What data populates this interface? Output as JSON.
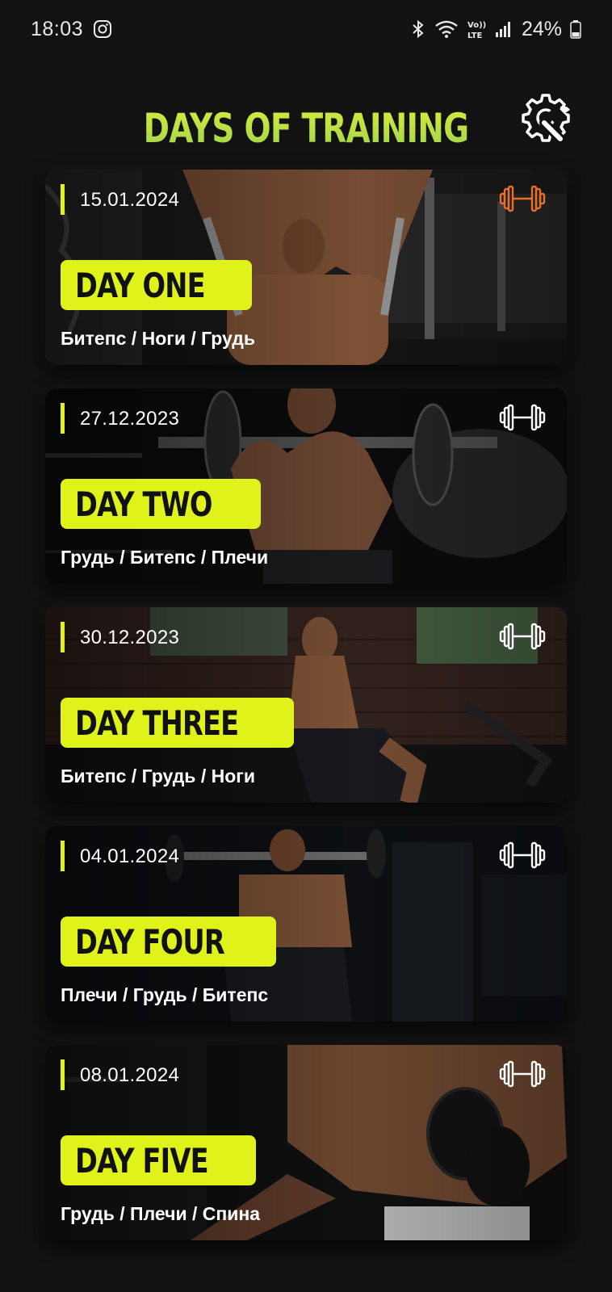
{
  "status_bar": {
    "time": "18:03",
    "battery": "24%",
    "icons": [
      "instagram-icon",
      "bluetooth-icon",
      "wifi-icon",
      "volte-icon",
      "signal-icon",
      "battery-icon"
    ]
  },
  "header": {
    "title": "DAYS OF TRAINING",
    "settings_icon": "settings-tools-icon"
  },
  "colors": {
    "accent": "#dff21a",
    "active_dumbbell": "#e8702a",
    "background": "#121212"
  },
  "cards": [
    {
      "date": "15.01.2024",
      "day": "DAY ONE",
      "muscles": "Битепс / Ноги / Грудь",
      "active": true
    },
    {
      "date": "27.12.2023",
      "day": "DAY TWO",
      "muscles": "Грудь / Битепс / Плечи",
      "active": false
    },
    {
      "date": "30.12.2023",
      "day": "DAY THREE",
      "muscles": "Битепс / Грудь / Ноги",
      "active": false
    },
    {
      "date": "04.01.2024",
      "day": "DAY FOUR",
      "muscles": "Плечи / Грудь / Битепс",
      "active": false
    },
    {
      "date": "08.01.2024",
      "day": "DAY FIVE",
      "muscles": "Грудь / Плечи / Спина",
      "active": false
    }
  ]
}
